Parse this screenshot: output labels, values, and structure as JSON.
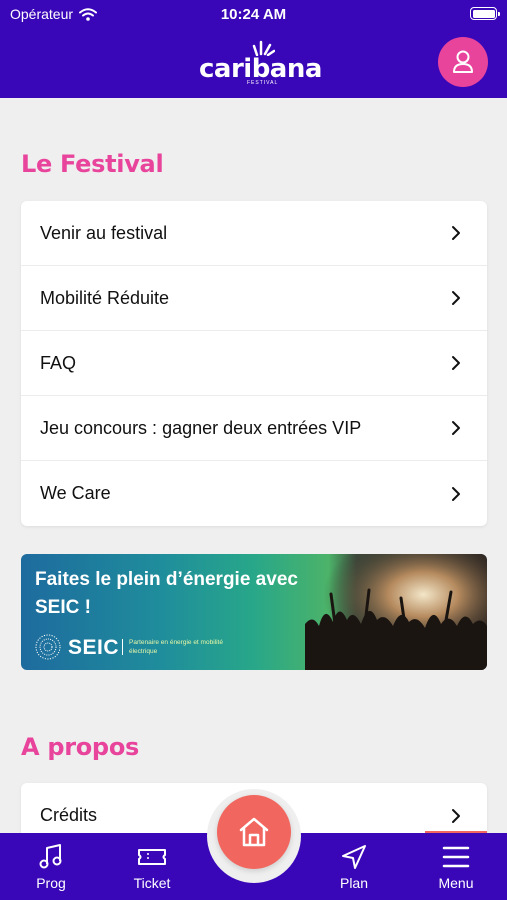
{
  "status_bar": {
    "carrier": "Opérateur",
    "time": "10:24 AM"
  },
  "header": {
    "logo_text": "caribana",
    "logo_subtitle": "FESTIVAL"
  },
  "festival_section": {
    "title": "Le Festival",
    "items": [
      {
        "label": "Venir au festival"
      },
      {
        "label": "Mobilité Réduite"
      },
      {
        "label": "FAQ"
      },
      {
        "label": "Jeu concours : gagner deux entrées VIP"
      },
      {
        "label": "We Care"
      }
    ]
  },
  "banner": {
    "title": "Faites le plein d’énergie avec SEIC !",
    "brand": "SEIC",
    "partner_text": "Partenaire en énergie et mobilité électrique"
  },
  "about_section": {
    "title": "A propos",
    "items": [
      {
        "label": "Crédits"
      }
    ]
  },
  "tabbar": {
    "tabs": [
      {
        "label": "Prog",
        "icon": "music-note-icon"
      },
      {
        "label": "Ticket",
        "icon": "ticket-icon"
      },
      {
        "label": "",
        "icon": "home-icon"
      },
      {
        "label": "Plan",
        "icon": "navigation-arrow-icon"
      },
      {
        "label": "Menu",
        "icon": "hamburger-menu-icon"
      }
    ],
    "active_tab": "Menu"
  },
  "colors": {
    "brand_purple": "#3a07b8",
    "accent_pink": "#e8449c",
    "accent_coral": "#f1675f",
    "background": "#efefef"
  }
}
